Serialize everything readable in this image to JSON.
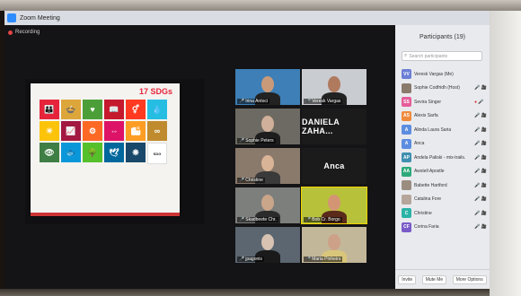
{
  "window": {
    "title": "Zoom Meeting"
  },
  "recording": {
    "label": "Recording"
  },
  "slide": {
    "title": "17 SDGs",
    "tiles": [
      {
        "color": "#e5243b",
        "glyph": "👪"
      },
      {
        "color": "#dda63a",
        "glyph": "🍲"
      },
      {
        "color": "#4c9f38",
        "glyph": "♥"
      },
      {
        "color": "#c5192d",
        "glyph": "📖"
      },
      {
        "color": "#ff3a21",
        "glyph": "⚥"
      },
      {
        "color": "#26bde2",
        "glyph": "💧"
      },
      {
        "color": "#fcc30b",
        "glyph": "☀"
      },
      {
        "color": "#a21942",
        "glyph": "📈"
      },
      {
        "color": "#fd6925",
        "glyph": "⚙"
      },
      {
        "color": "#dd1367",
        "glyph": "⇔"
      },
      {
        "color": "#fd9d24",
        "glyph": "🏙"
      },
      {
        "color": "#bf8b2e",
        "glyph": "∞"
      },
      {
        "color": "#3f7e44",
        "glyph": "👁"
      },
      {
        "color": "#0a97d9",
        "glyph": "🐟"
      },
      {
        "color": "#56c02b",
        "glyph": "🌳"
      },
      {
        "color": "#00689d",
        "glyph": "🕊"
      },
      {
        "color": "#19486a",
        "glyph": "❋"
      },
      {
        "color": "#ffffff",
        "glyph": "SDG"
      }
    ]
  },
  "gallery": [
    {
      "name": "Irina Antoci",
      "bg": "#3d7fb6",
      "skin": "#c99a7a",
      "shirt": "#222",
      "active": false
    },
    {
      "name": "Veresk Vargas",
      "bg": "#c9ccd1",
      "skin": "#b07a5f",
      "shirt": "#222",
      "active": false
    },
    {
      "name": "Sophie Peters",
      "bg": "#6c6a62",
      "skin": "#d0b09a",
      "shirt": "#1d1d1d",
      "active": false
    },
    {
      "name": "",
      "text": "DANIELA ZAHA...",
      "active": false
    },
    {
      "name": "Christine",
      "bg": "#8a7a6c",
      "skin": "#d9b497",
      "shirt": "#3a3a3a",
      "active": false
    },
    {
      "name": "",
      "text": "Anca",
      "active": false
    },
    {
      "name": "Skadbeete Chr.",
      "bg": "#7d7f7c",
      "skin": "#c9a58a",
      "shirt": "#2b2b2b",
      "active": false
    },
    {
      "name": "Bob Cr. Borgo",
      "bg": "#b7c23a",
      "skin": "#d49574",
      "shirt": "#5a2b1a",
      "active": true
    },
    {
      "name": "jpagonis",
      "bg": "#5b6670",
      "skin": "#d8c2b2",
      "shirt": "#1a1a1a",
      "active": false
    },
    {
      "name": "Maria Pinheiro",
      "bg": "#c3b79a",
      "skin": "#cda187",
      "shirt": "#d9c67a",
      "active": false
    }
  ],
  "participants": {
    "title": "Participants (19)",
    "search_placeholder": "Search participants",
    "list": [
      {
        "initials": "VV",
        "color": "#6b7fd6",
        "name": "Veresk Vargas (Me)",
        "icons": ""
      },
      {
        "initials": "",
        "color": "#8a7a6c",
        "name": "Sophie Codfridh (Host)",
        "icons": "🎤 🎥"
      },
      {
        "initials": "SS",
        "color": "#e55d9a",
        "name": "Sevira Singer",
        "icons": "● 🎤"
      },
      {
        "initials": "AS",
        "color": "#f08a3c",
        "name": "Alexis Sarfa",
        "icons": "🎤 🎥"
      },
      {
        "initials": "A",
        "color": "#5c8de0",
        "name": "Alinda Laura Saria",
        "icons": "🎤 🎥"
      },
      {
        "initials": "A",
        "color": "#5c8de0",
        "name": "Anca",
        "icons": "🎤 🎥"
      },
      {
        "initials": "AP",
        "color": "#3f8fb0",
        "name": "Andela Paliski - mix-trails.",
        "icons": "🎤 🎥"
      },
      {
        "initials": "AA",
        "color": "#2eaa7a",
        "name": "Awstell Apostle",
        "icons": "🎤 🎥"
      },
      {
        "initials": "",
        "color": "#9a8d80",
        "name": "Babette Hartford",
        "icons": "🎤 🎥"
      },
      {
        "initials": "",
        "color": "#b5a59a",
        "name": "Catalina Fore",
        "icons": "🎤 🎥"
      },
      {
        "initials": "C",
        "color": "#2bb3a6",
        "name": "Christine",
        "icons": "🎤 🎥"
      },
      {
        "initials": "CF",
        "color": "#7a5bc9",
        "name": "Corina Faria",
        "icons": "🎤 🎥"
      }
    ],
    "footer": [
      "Invite",
      "Mute Me",
      "More Options"
    ]
  }
}
